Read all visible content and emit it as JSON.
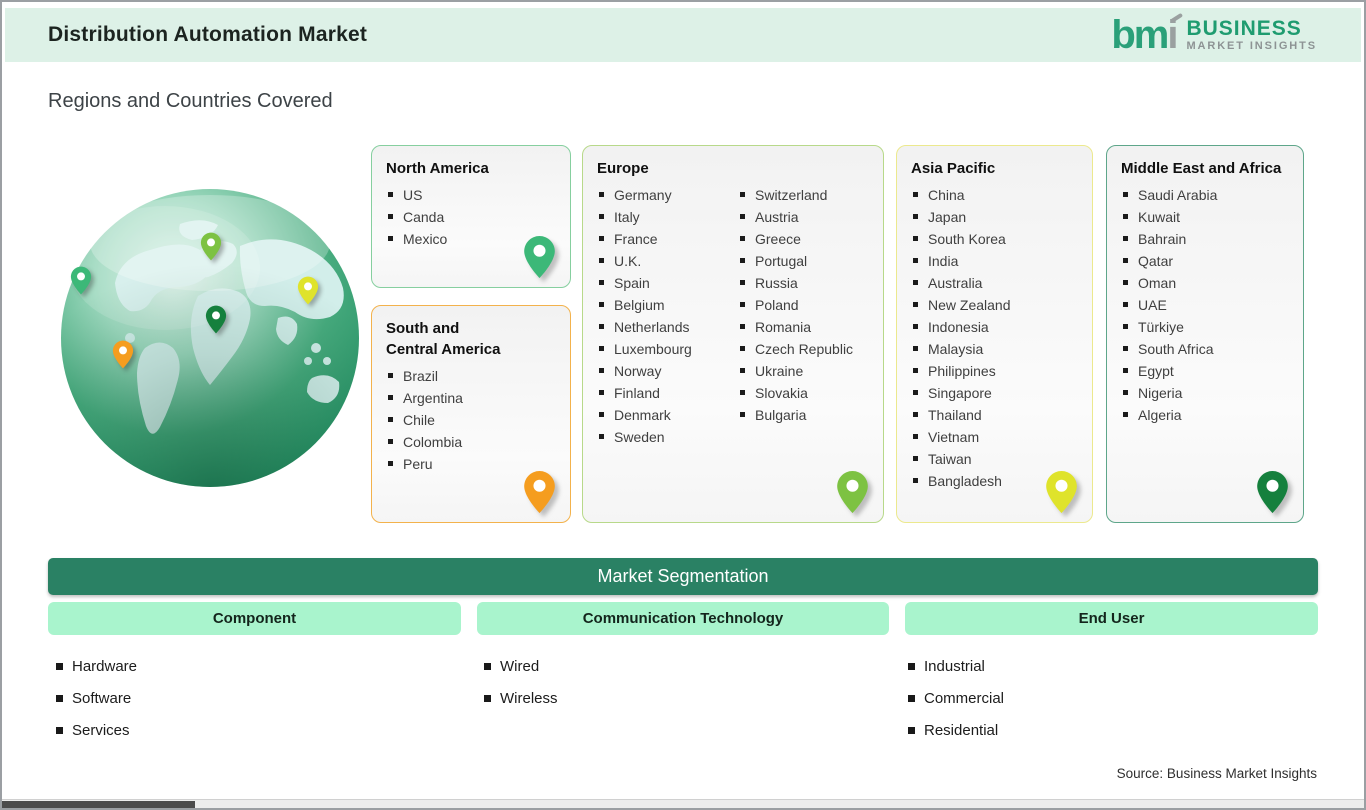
{
  "header": {
    "title": "Distribution Automation Market",
    "logo": {
      "mark_green": "bm",
      "mark_gray": "i",
      "line1": "BUSINESS",
      "line2": "MARKET INSIGHTS"
    }
  },
  "section_title": "Regions and Countries Covered",
  "regions": [
    {
      "name": "North America",
      "countries": [
        "US",
        "Canda",
        "Mexico"
      ],
      "border_color": "#86cf9f",
      "pin_color": "#3cb878"
    },
    {
      "name": "South and\nCentral America",
      "countries": [
        "Brazil",
        "Argentina",
        "Chile",
        "Colombia",
        "Peru"
      ],
      "border_color": "#f3b24c",
      "pin_color": "#f59d1f"
    },
    {
      "name": "Europe",
      "countries": [
        "Germany",
        "Italy",
        "France",
        "U.K.",
        "Spain",
        "Belgium",
        "Netherlands",
        "Luxembourg",
        "Norway",
        "Finland",
        "Denmark",
        "Sweden",
        "Switzerland",
        "Austria",
        "Greece",
        "Portugal",
        "Russia",
        "Poland",
        "Romania",
        "Czech Republic",
        "Ukraine",
        "Slovakia",
        "Bulgaria"
      ],
      "border_color": "#b8d98a",
      "pin_color": "#7dc242"
    },
    {
      "name": "Asia Pacific",
      "countries": [
        "China",
        "Japan",
        "South Korea",
        "India",
        "Australia",
        "New Zealand",
        "Indonesia",
        "Malaysia",
        "Philippines",
        "Singapore",
        "Thailand",
        "Vietnam",
        "Taiwan",
        "Bangladesh"
      ],
      "border_color": "#ece98e",
      "pin_color": "#dfe32b"
    },
    {
      "name": "Middle East and Africa",
      "countries": [
        "Saudi Arabia",
        "Kuwait",
        "Bahrain",
        "Qatar",
        "Oman",
        "UAE",
        "Türkiye",
        "South Africa",
        "Egypt",
        "Nigeria",
        "Algeria"
      ],
      "border_color": "#5ea68a",
      "pin_color": "#15803d"
    }
  ],
  "globe": {
    "pin_colors": [
      "#3cb878",
      "#7dc242",
      "#dfe32b",
      "#15803d",
      "#f59d1f"
    ]
  },
  "segmentation": {
    "title": "Market Segmentation",
    "banner_color": "#2a8164",
    "pill_color": "#a9f4cd",
    "columns": [
      {
        "label": "Component",
        "items": [
          "Hardware",
          "Software",
          "Services"
        ]
      },
      {
        "label": "Communication Technology",
        "items": [
          "Wired",
          "Wireless"
        ]
      },
      {
        "label": "End User",
        "items": [
          "Industrial",
          "Commercial",
          "Residential"
        ]
      }
    ]
  },
  "source_note": "Source: Business Market Insights"
}
